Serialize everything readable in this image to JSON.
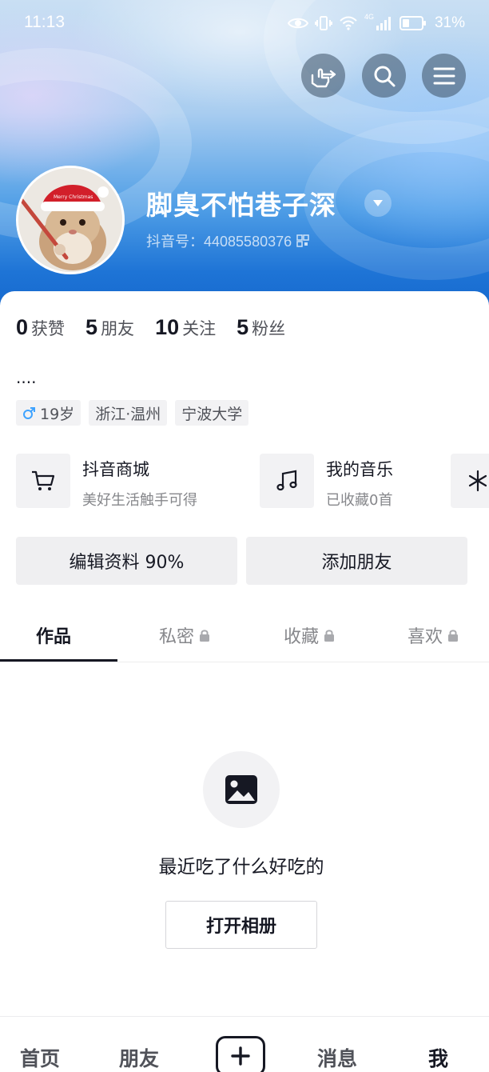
{
  "status_bar": {
    "time": "11:13",
    "network": "4G",
    "battery": "31%"
  },
  "header": {
    "buttons": [
      "tap-icon",
      "search-icon",
      "menu-icon"
    ]
  },
  "profile": {
    "nickname": "脚臭不怕巷子深",
    "douyin_id": "抖音号：44085580376",
    "bio": "....",
    "avatar_text": "Merry Christmas"
  },
  "stats": [
    {
      "num": "0",
      "label": "获赞"
    },
    {
      "num": "5",
      "label": "朋友"
    },
    {
      "num": "10",
      "label": "关注"
    },
    {
      "num": "5",
      "label": "粉丝"
    }
  ],
  "tags": [
    {
      "icon": "male-icon",
      "text": "19岁"
    },
    {
      "text": "浙江·温州"
    },
    {
      "text": "宁波大学"
    }
  ],
  "features": [
    {
      "icon": "cart-icon",
      "title": "抖音商城",
      "subtitle": "美好生活触手可得"
    },
    {
      "icon": "music-icon",
      "title": "我的音乐",
      "subtitle": "已收藏0首"
    }
  ],
  "actions": {
    "edit": "编辑资料 90%",
    "add_friend": "添加朋友"
  },
  "tabs": [
    {
      "label": "作品",
      "locked": false,
      "active": true
    },
    {
      "label": "私密",
      "locked": true
    },
    {
      "label": "收藏",
      "locked": true
    },
    {
      "label": "喜欢",
      "locked": true
    }
  ],
  "empty_state": {
    "text": "最近吃了什么好吃的",
    "button": "打开相册"
  },
  "bottom_nav": [
    {
      "label": "首页"
    },
    {
      "label": "朋友"
    },
    {
      "label": "消息"
    },
    {
      "label": "我",
      "active": true
    }
  ]
}
